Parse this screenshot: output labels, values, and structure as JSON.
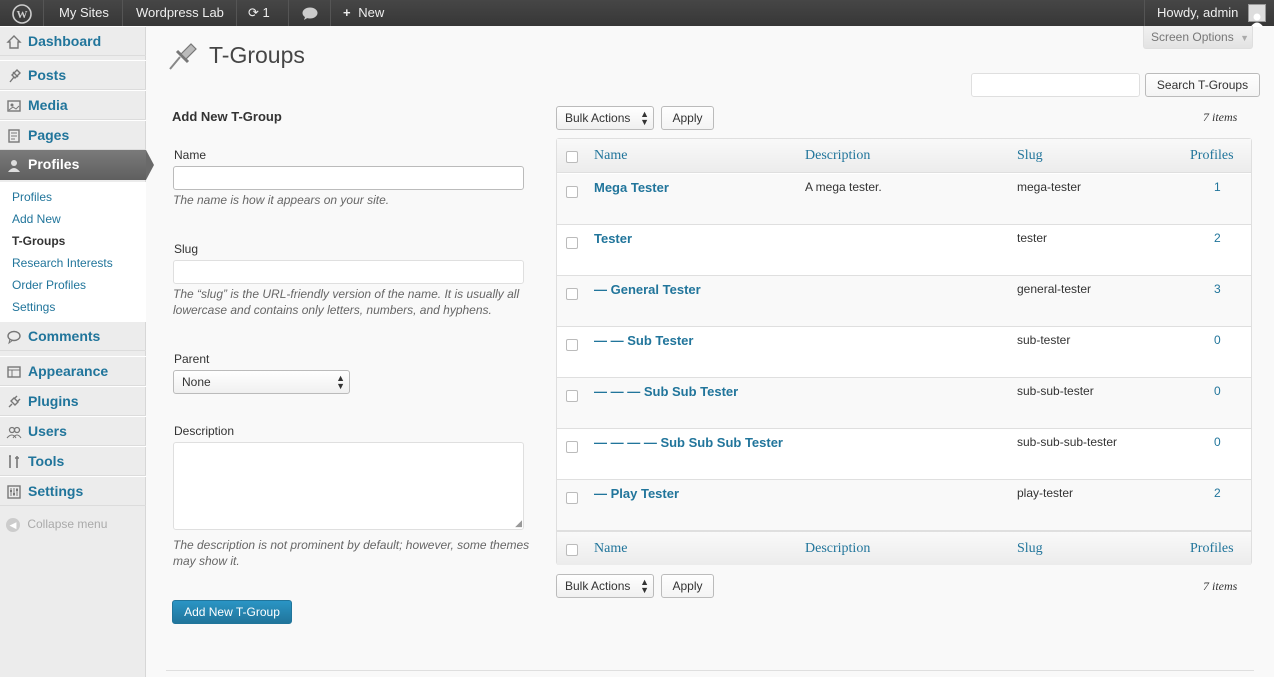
{
  "adminbar": {
    "wp_icon": "wordpress-logo-icon",
    "my_sites": "My Sites",
    "site_name": "Wordpress Lab",
    "updates_count": "1",
    "new_label": "New",
    "howdy": "Howdy, admin"
  },
  "sidebar": {
    "items": [
      {
        "label": "Dashboard",
        "icon": "dashboard-icon"
      },
      {
        "label": "Posts",
        "icon": "pin-icon"
      },
      {
        "label": "Media",
        "icon": "media-icon"
      },
      {
        "label": "Pages",
        "icon": "pages-icon"
      },
      {
        "label": "Profiles",
        "icon": "user-icon"
      },
      {
        "label": "Comments",
        "icon": "comment-icon"
      },
      {
        "label": "Appearance",
        "icon": "appearance-icon"
      },
      {
        "label": "Plugins",
        "icon": "plugin-icon"
      },
      {
        "label": "Users",
        "icon": "users-icon"
      },
      {
        "label": "Tools",
        "icon": "tools-icon"
      },
      {
        "label": "Settings",
        "icon": "settings-icon"
      }
    ],
    "submenu": [
      "Profiles",
      "Add New",
      "T-Groups",
      "Research Interests",
      "Order Profiles",
      "Settings"
    ],
    "collapse_label": "Collapse menu"
  },
  "header": {
    "title": "T-Groups",
    "screen_options": "Screen Options",
    "search_button": "Search T-Groups"
  },
  "form": {
    "heading": "Add New T-Group",
    "name_label": "Name",
    "name_hint": "The name is how it appears on your site.",
    "slug_label": "Slug",
    "slug_hint_1": "The “slug” is the URL-friendly version of the name. It is usually all",
    "slug_hint_2": "lowercase and contains only letters, numbers, and hyphens.",
    "parent_label": "Parent",
    "parent_value": "None",
    "description_label": "Description",
    "description_hint_1": "The description is not prominent by default; however, some themes",
    "description_hint_2": "may show it.",
    "submit": "Add New T-Group"
  },
  "list": {
    "bulk_actions": "Bulk Actions",
    "apply": "Apply",
    "items_count": "7 items",
    "columns": {
      "name": "Name",
      "description": "Description",
      "slug": "Slug",
      "profiles": "Profiles"
    },
    "rows": [
      {
        "name": "Mega Tester",
        "description": "A mega tester.",
        "slug": "mega-tester",
        "count": "1"
      },
      {
        "name": "Tester",
        "description": "",
        "slug": "tester",
        "count": "2"
      },
      {
        "name": "— General Tester",
        "description": "",
        "slug": "general-tester",
        "count": "3"
      },
      {
        "name": "— — Sub Tester",
        "description": "",
        "slug": "sub-tester",
        "count": "0"
      },
      {
        "name": "— — — Sub Sub Tester",
        "description": "",
        "slug": "sub-sub-tester",
        "count": "0"
      },
      {
        "name": "— — — — Sub Sub Sub Tester",
        "description": "",
        "slug": "sub-sub-sub-tester",
        "count": "0"
      },
      {
        "name": "— Play Tester",
        "description": "",
        "slug": "play-tester",
        "count": "2"
      }
    ]
  }
}
